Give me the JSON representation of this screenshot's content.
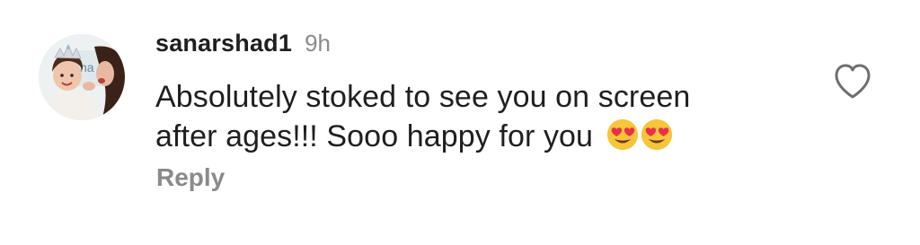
{
  "comment": {
    "username": "sanarshad1",
    "timestamp": "9h",
    "text_line1": "Absolutely stoked to see you on screen",
    "text_line2": "after ages!!! Sooo happy for you",
    "emojis": [
      "heart-eyes-emoji",
      "heart-eyes-emoji"
    ],
    "reply_label": "Reply",
    "like_icon": "heart-outline-icon"
  },
  "colors": {
    "text": "#1f1f1f",
    "muted": "#8a8a8a",
    "emoji_face": "#f7c53a",
    "emoji_heart": "#e8304a"
  }
}
